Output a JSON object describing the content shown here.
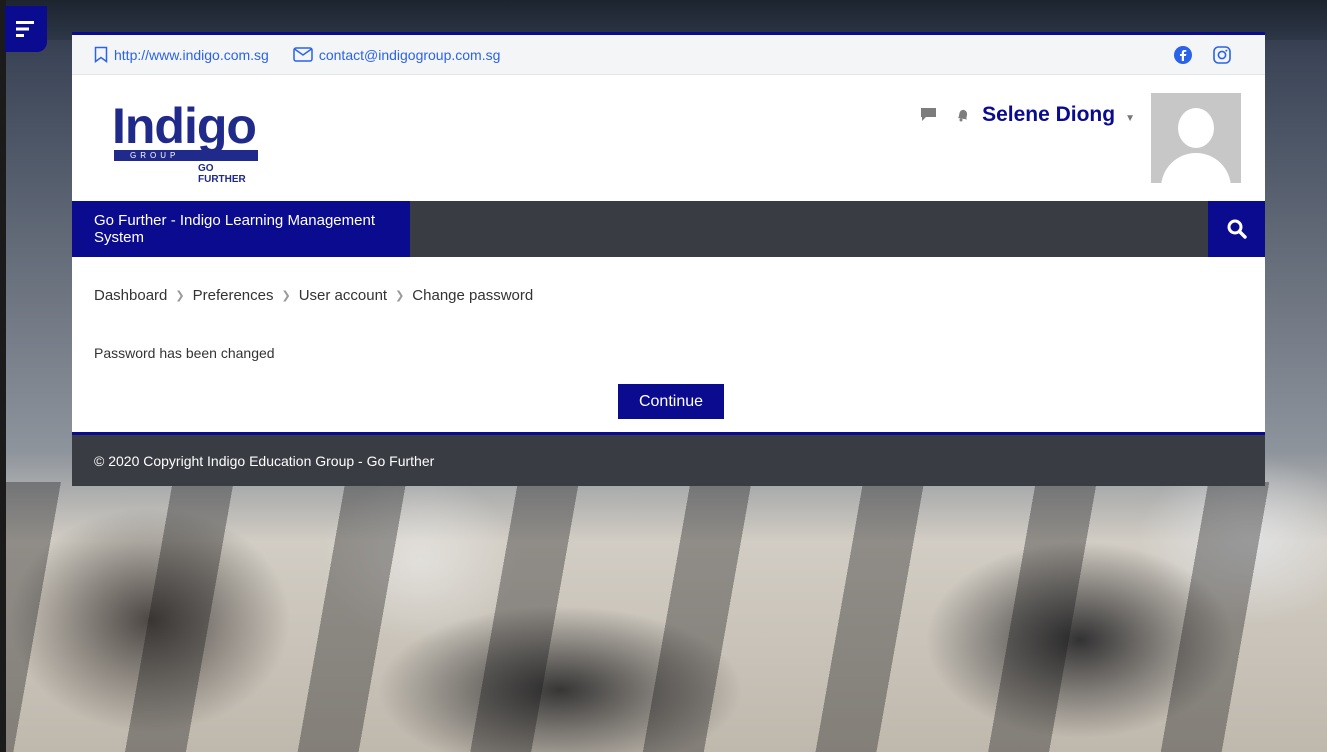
{
  "colors": {
    "brand": "#0a0b8f",
    "link": "#2a63e8",
    "dark_bar": "#3a3c43"
  },
  "topbar": {
    "website": "http://www.indigo.com.sg",
    "email": "contact@indigogroup.com.sg",
    "icons": [
      "bookmark-icon",
      "mail-icon",
      "facebook-icon",
      "instagram-icon"
    ]
  },
  "logo": {
    "name": "Indigo",
    "band": "GROUP",
    "tagline": "GO FURTHER"
  },
  "user": {
    "name": "Selene Diong",
    "icons": [
      "message-icon",
      "bell-icon"
    ]
  },
  "nav": {
    "site_title": "Go Further - Indigo Learning Management System"
  },
  "breadcrumb": {
    "items": [
      "Dashboard",
      "Preferences",
      "User account",
      "Change password"
    ]
  },
  "main": {
    "message": "Password has been changed",
    "continue_label": "Continue"
  },
  "footer": {
    "copyright": "© 2020 Copyright Indigo Education Group - Go Further"
  }
}
